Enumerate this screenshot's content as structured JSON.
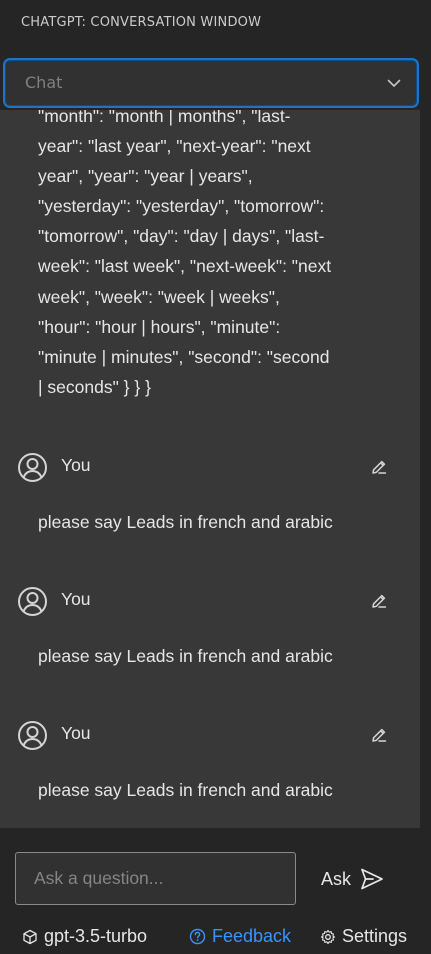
{
  "panel": {
    "title": "CHATGPT: CONVERSATION WINDOW"
  },
  "chat_select": {
    "value": "Chat",
    "icon": "chevron-down-icon"
  },
  "conversation": {
    "previous_response_text": "\"month\": \"month | months\", \"last-\nyear\": \"last year\", \"next-year\": \"next\nyear\", \"year\": \"year | years\",\n\"yesterday\": \"yesterday\", \"tomorrow\":\n\"tomorrow\", \"day\": \"day | days\", \"last-\nweek\": \"last week\", \"next-week\": \"next\nweek\", \"week\": \"week | weeks\",\n\"hour\": \"hour | hours\", \"minute\":\n\"minute | minutes\", \"second\": \"second\n| seconds\" } } }",
    "messages": [
      {
        "author": "You",
        "text": "please say Leads in french and arabic",
        "avatar_icon": "user-icon",
        "edit_icon": "edit-icon"
      },
      {
        "author": "You",
        "text": "please say Leads in french and arabic",
        "avatar_icon": "user-icon",
        "edit_icon": "edit-icon"
      },
      {
        "author": "You",
        "text": "please say Leads in french and arabic",
        "avatar_icon": "user-icon",
        "edit_icon": "edit-icon"
      }
    ]
  },
  "composer": {
    "placeholder": "Ask a question...",
    "value": "",
    "ask_label": "Ask",
    "ask_icon": "send-icon"
  },
  "footer": {
    "model": "gpt-3.5-turbo",
    "model_icon": "cube-icon",
    "feedback": "Feedback",
    "feedback_icon": "question-circle-icon",
    "settings": "Settings",
    "settings_icon": "gear-icon"
  },
  "colors": {
    "background": "#252526",
    "conversation_bg": "#383838",
    "focus_border": "#1e73c4",
    "link": "#3794ff",
    "text": "#e6e6e6"
  }
}
